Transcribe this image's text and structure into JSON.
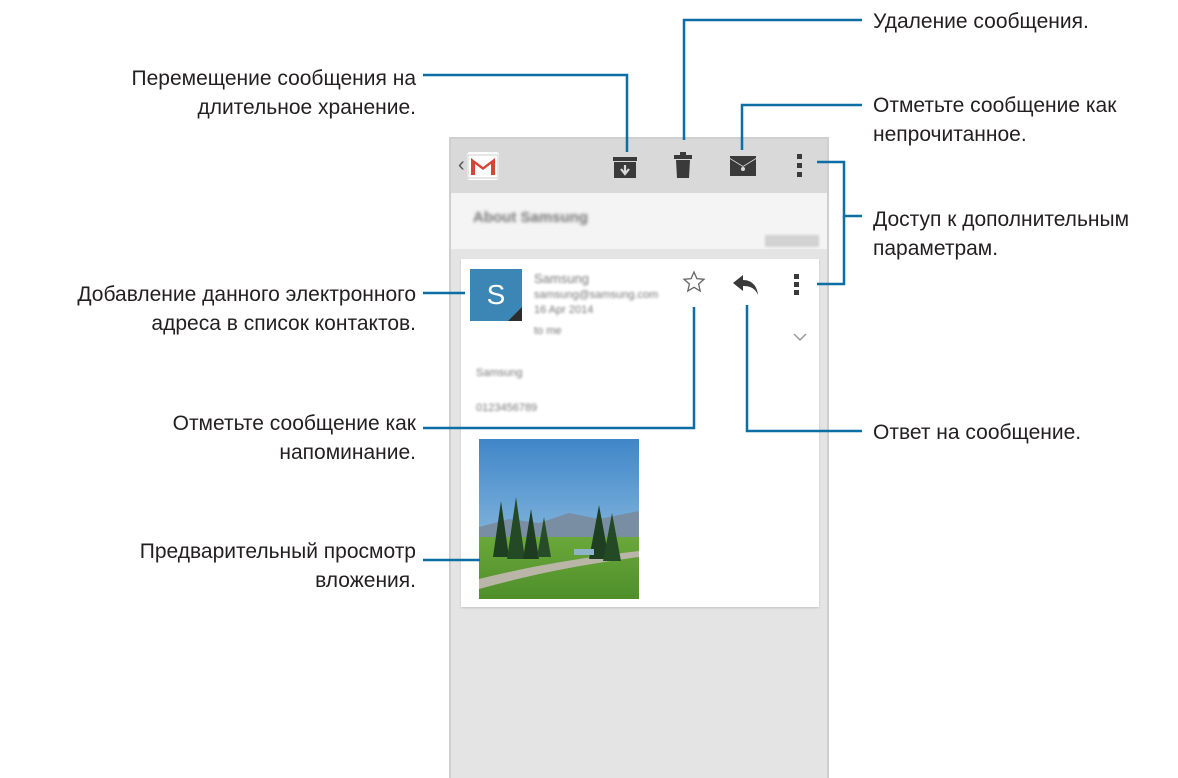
{
  "callouts": {
    "archive": [
      "Перемещение сообщения на",
      "длительное хранение."
    ],
    "delete": [
      "Удаление сообщения."
    ],
    "mark_unread": [
      "Отметьте сообщение как",
      "непрочитанное."
    ],
    "more_options": [
      "Доступ к дополнительным",
      "параметрам."
    ],
    "add_contact": [
      "Добавление данного электронного",
      "адреса в список контактов."
    ],
    "star": [
      "Отметьте сообщение как",
      "напоминание."
    ],
    "reply": [
      "Ответ на сообщение."
    ],
    "attachment": [
      "Предварительный просмотр",
      "вложения."
    ]
  },
  "phone": {
    "subject": "About Samsung",
    "avatar_letter": "S",
    "sender": {
      "name": "Samsung",
      "email": "samsung@samsung.com",
      "date": "16 Apr 2014",
      "to": "to me"
    },
    "body": {
      "line1": "Samsung",
      "line2": "0123456789"
    }
  },
  "colors": {
    "callout_line": "#0b6fa4",
    "avatar": "#3b86b5",
    "gmail_red": "#d44638"
  },
  "icons": [
    "back-icon",
    "gmail-logo",
    "archive-icon",
    "trash-icon",
    "mark-unread-icon",
    "overflow-menu-icon",
    "star-icon",
    "reply-icon",
    "expand-icon"
  ]
}
